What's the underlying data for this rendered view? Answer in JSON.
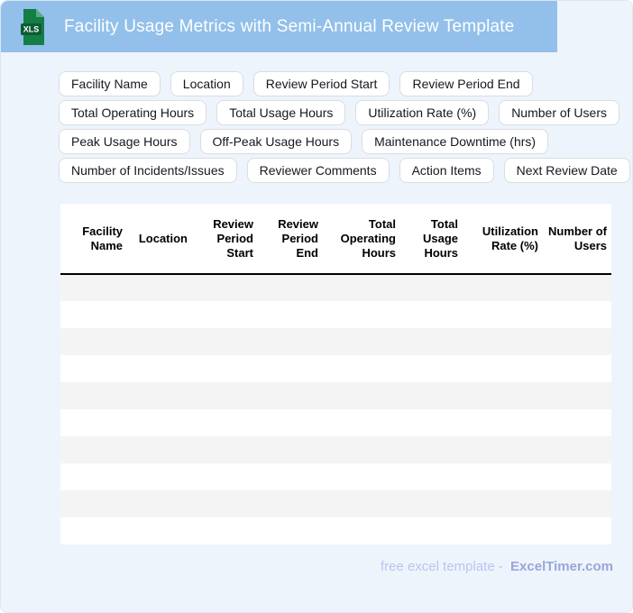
{
  "header": {
    "title": "Facility Usage Metrics with Semi-Annual Review Template",
    "file_badge": "XLS"
  },
  "chips": {
    "rows": [
      [
        "Facility Name",
        "Location",
        "Review Period Start",
        "Review Period End"
      ],
      [
        "Total Operating Hours",
        "Total Usage Hours",
        "Utilization Rate (%)",
        "Number of Users"
      ],
      [
        "Peak Usage Hours",
        "Off-Peak Usage Hours",
        "Maintenance Downtime (hrs)"
      ],
      [
        "Number of Incidents/Issues",
        "Reviewer Comments",
        "Action Items",
        "Next Review Date"
      ]
    ]
  },
  "table": {
    "columns": [
      "Facility Name",
      "Location",
      "Review Period Start",
      "Review Period End",
      "Total Operating Hours",
      "Total Usage Hours",
      "Utilization Rate (%)",
      "Number of Users"
    ],
    "empty_row_count": 10
  },
  "footer": {
    "prefix": "free excel template -",
    "brand": "ExcelTimer.com"
  },
  "colors": {
    "titlebar_blue": "#92c0ea",
    "page_background": "#eef4fc",
    "stripe_gray": "#f4f4f5",
    "icon_green": "#157d46",
    "icon_banner_green": "#0b5c33",
    "footer_text": "#b9c5ee",
    "footer_brand": "#98a6da"
  }
}
